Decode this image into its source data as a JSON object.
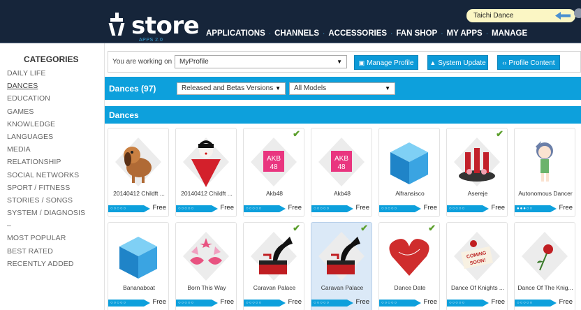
{
  "header": {
    "logo_text": "store",
    "logo_subtitle": "APPS 2.0",
    "nav": [
      "APPLICATIONS",
      "CHANNELS",
      "ACCESSORIES",
      "FAN SHOP",
      "MY APPS",
      "MANAGE"
    ],
    "user_name": "Taichi Dance"
  },
  "sidebar": {
    "title": "CATEGORIES",
    "categories": [
      "DAILY LIFE",
      "DANCES",
      "EDUCATION",
      "GAMES",
      "KNOWLEDGE",
      "LANGUAGES",
      "MEDIA",
      "RELATIONSHIP",
      "SOCIAL NETWORKS",
      "SPORT / FITNESS",
      "STORIES / SONGS",
      "SYSTEM / DIAGNOSIS"
    ],
    "separator": "–",
    "extras": [
      "MOST POPULAR",
      "BEST RATED",
      "RECENTLY ADDED"
    ]
  },
  "workbar": {
    "label": "You are working on :",
    "profile": "MyProfile",
    "manage_profile": "Manage Profile",
    "system_update": "System Update",
    "profile_content": "Profile Content"
  },
  "filterbar": {
    "title": "Dances (97)",
    "version_filter": "Released and Betas Versions",
    "model_filter": "All Models"
  },
  "section": {
    "title": "Dances"
  },
  "apps": [
    {
      "name": "20140412 Childft ...",
      "price": "Free",
      "rating": "○○○○○",
      "installed": false,
      "thumb": "dog-icon"
    },
    {
      "name": "20140412 Childft ...",
      "price": "Free",
      "rating": "○○○○○",
      "installed": false,
      "thumb": "geisha-icon"
    },
    {
      "name": "Akb48",
      "price": "Free",
      "rating": "○○○○○",
      "installed": true,
      "thumb": "akb48-icon"
    },
    {
      "name": "Akb48",
      "price": "Free",
      "rating": "○○○○○",
      "installed": false,
      "thumb": "akb48-icon"
    },
    {
      "name": "Alfransisco",
      "price": "Free",
      "rating": "○○○○○",
      "installed": false,
      "thumb": "cube-icon"
    },
    {
      "name": "Asereje",
      "price": "Free",
      "rating": "○○○○○",
      "installed": true,
      "thumb": "bottles-icon"
    },
    {
      "name": "Autonomous Dancer",
      "price": "Free",
      "rating": "●●●○○",
      "installed": false,
      "thumb": "anime-girl-icon"
    },
    {
      "name": "Bananaboat",
      "price": "Free",
      "rating": "○○○○○",
      "installed": false,
      "thumb": "cube-icon"
    },
    {
      "name": "Born This Way",
      "price": "Free",
      "rating": "○○○○○",
      "installed": false,
      "thumb": "glasses-icon"
    },
    {
      "name": "Caravan Palace",
      "price": "Free",
      "rating": "○○○○○",
      "installed": true,
      "thumb": "gramophone-icon"
    },
    {
      "name": "Caravan Palace",
      "price": "Free",
      "rating": "○○○○○",
      "installed": true,
      "thumb": "gramophone-icon"
    },
    {
      "name": "Dance Date",
      "price": "Free",
      "rating": "○○○○○",
      "installed": true,
      "thumb": "heart-icon"
    },
    {
      "name": "Dance Of Knights ...",
      "price": "Free",
      "rating": "○○○○○",
      "installed": false,
      "thumb": "coming-soon-icon"
    },
    {
      "name": "Dance Of The Knig...",
      "price": "Free",
      "rating": "○○○○○",
      "installed": false,
      "thumb": "rose-icon"
    }
  ],
  "colors": {
    "header_bg": "#16253a",
    "accent_blue": "#0da0dc",
    "check_green": "#5a9e2a",
    "user_box_bg": "#fbf6c4",
    "selected_card": "#dbe9f7"
  },
  "selected_app_index": 10
}
